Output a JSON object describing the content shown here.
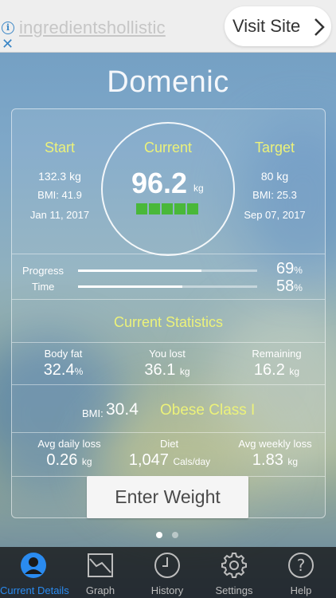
{
  "ad": {
    "text": "ingredientshollistic",
    "button_label": "Visit Site",
    "info_icon": "info-icon",
    "close_icon": "close-icon"
  },
  "profile": {
    "name": "Domenic"
  },
  "summary": {
    "start": {
      "title": "Start",
      "weight": "132.3 kg",
      "bmi": "BMI: 41.9",
      "date": "Jan 11, 2017"
    },
    "current": {
      "title": "Current",
      "value": "96.2",
      "unit": "kg",
      "blocks_filled": 5,
      "blocks_total": 5
    },
    "target": {
      "title": "Target",
      "weight": "80 kg",
      "bmi": "BMI: 25.3",
      "date": "Sep 07, 2017"
    }
  },
  "progress": {
    "progress_label": "Progress",
    "progress_pct": "69",
    "progress_fraction": 0.69,
    "time_label": "Time",
    "time_pct": "58",
    "time_fraction": 0.58,
    "pct_symbol": "%"
  },
  "stats": {
    "title": "Current Statistics",
    "body_fat": {
      "label": "Body fat",
      "value": "32.4",
      "unit": "%"
    },
    "lost": {
      "label": "You lost",
      "value": "36.1",
      "unit": "kg"
    },
    "remaining": {
      "label": "Remaining",
      "value": "16.2",
      "unit": "kg"
    },
    "bmi": {
      "label": "BMI:",
      "value": "30.4",
      "class": "Obese Class I"
    },
    "avg_daily": {
      "label": "Avg daily loss",
      "value": "0.26",
      "unit": "kg"
    },
    "diet": {
      "label": "Diet",
      "value": "1,047",
      "unit": "Cals/day"
    },
    "avg_weekly": {
      "label": "Avg weekly loss",
      "value": "1.83",
      "unit": "kg"
    }
  },
  "actions": {
    "enter_weight": "Enter Weight"
  },
  "pager": {
    "pages": 2,
    "active": 0
  },
  "tabs": [
    {
      "label": "Current Details",
      "icon": "person-icon",
      "active": true
    },
    {
      "label": "Graph",
      "icon": "graph-icon",
      "active": false
    },
    {
      "label": "History",
      "icon": "clock-icon",
      "active": false
    },
    {
      "label": "Settings",
      "icon": "gear-icon",
      "active": false
    },
    {
      "label": "Help",
      "icon": "help-icon",
      "active": false
    }
  ],
  "colors": {
    "accent_yellow": "#ecf27a",
    "progress_green": "#49b83a",
    "tab_active": "#2a8bf0"
  }
}
